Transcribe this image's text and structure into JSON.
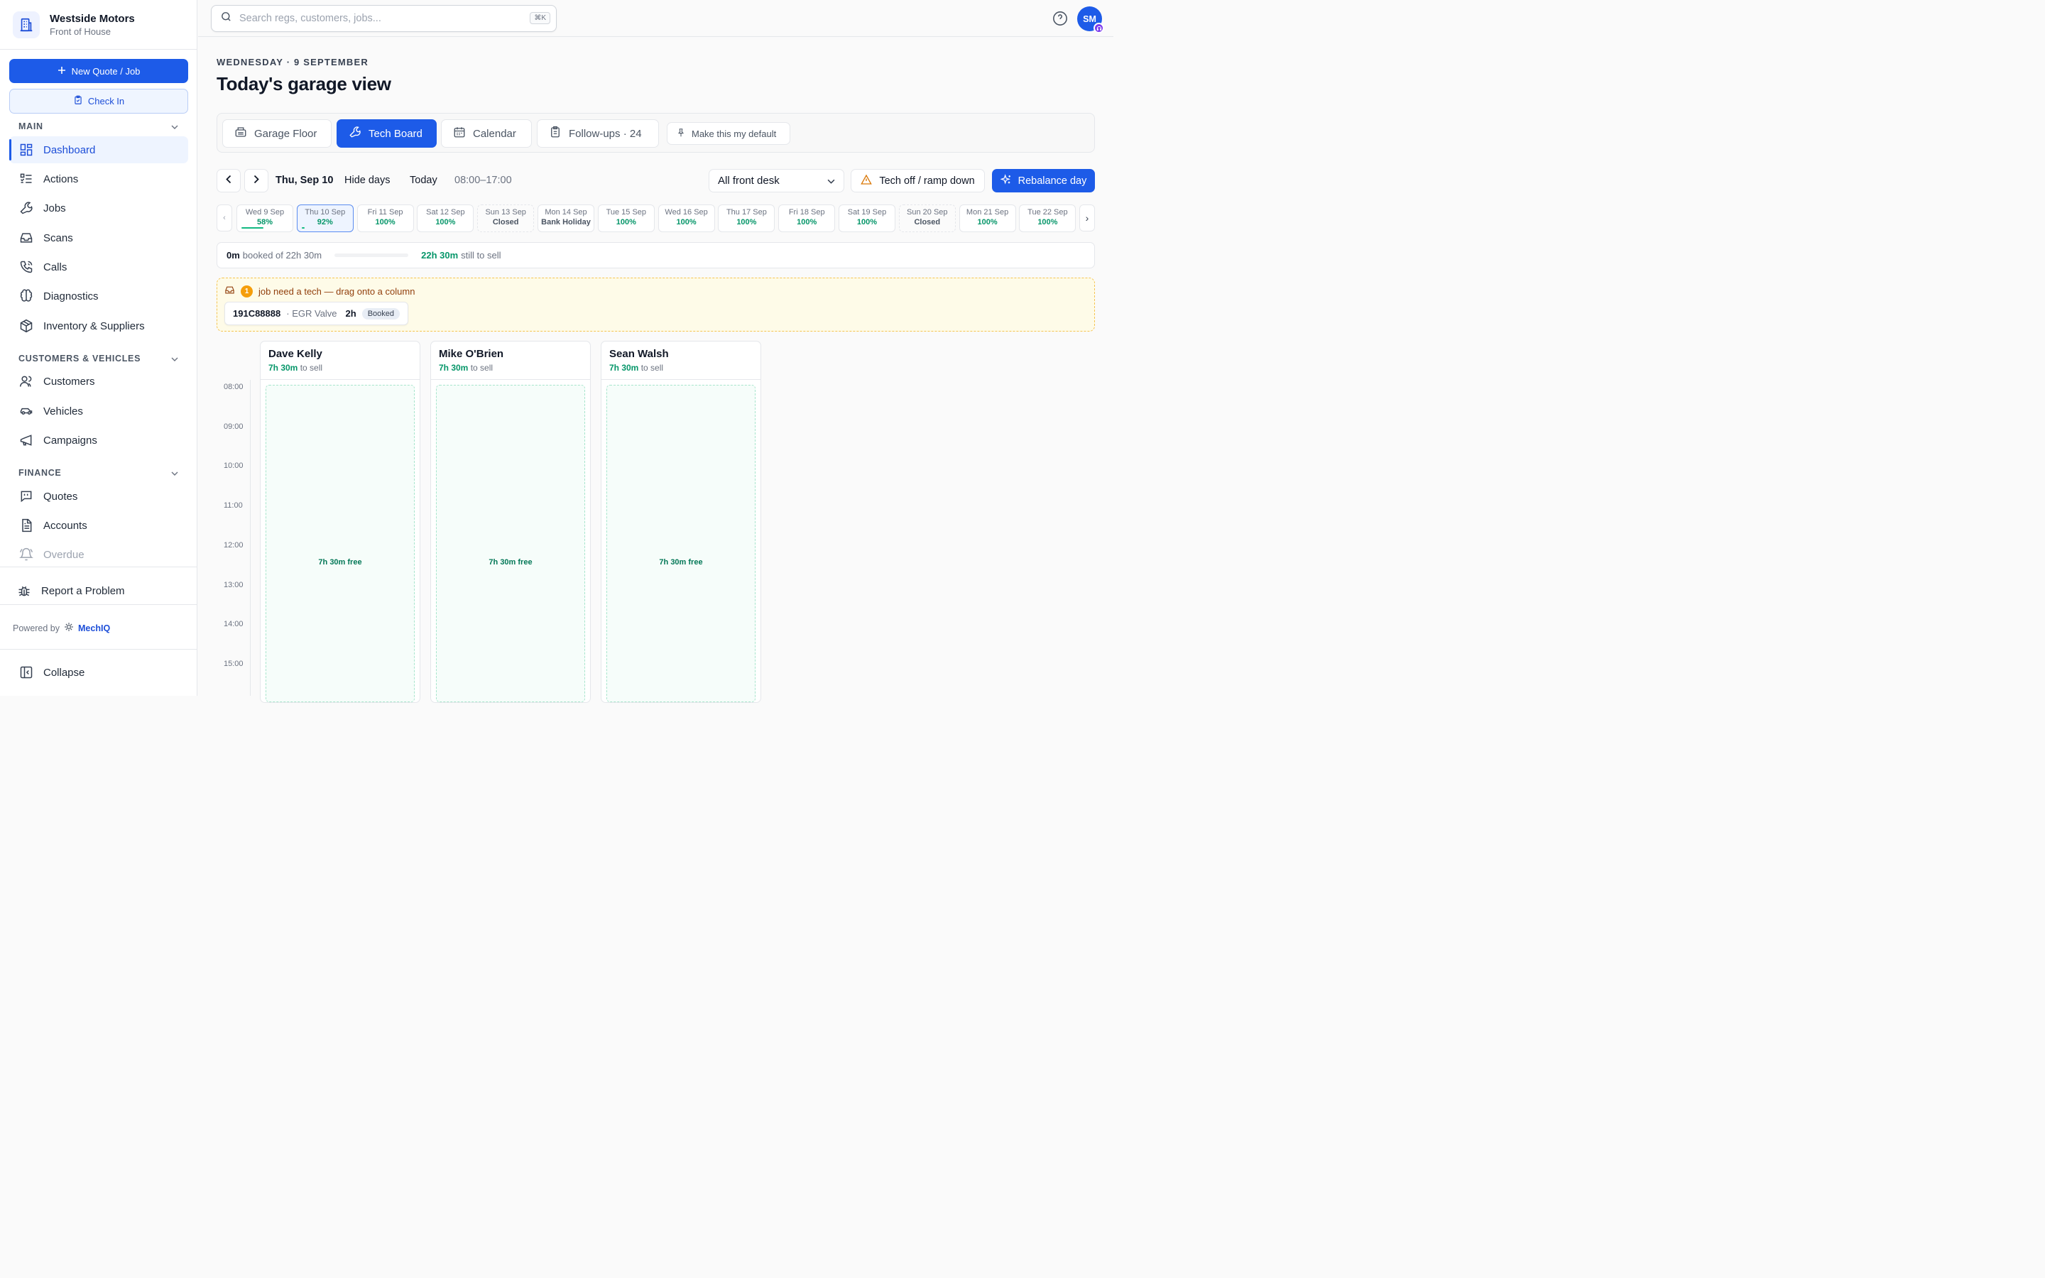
{
  "brand": {
    "name": "Westside Motors",
    "subtitle": "Front of House"
  },
  "sidebar": {
    "new_button": "New Quote / Job",
    "checkin_button": "Check In",
    "sections": {
      "main": "MAIN",
      "customers": "CUSTOMERS & VEHICLES",
      "finance": "FINANCE"
    },
    "main_items": [
      "Dashboard",
      "Actions",
      "Jobs",
      "Scans",
      "Calls",
      "Diagnostics",
      "Inventory & Suppliers"
    ],
    "customer_items": [
      "Customers",
      "Vehicles",
      "Campaigns"
    ],
    "finance_items": [
      "Quotes",
      "Accounts",
      "Overdue"
    ],
    "report": "Report a Problem",
    "powered_by": "Powered by",
    "powered_brand": "MechIQ",
    "collapse": "Collapse",
    "active_item": "Dashboard"
  },
  "topbar": {
    "search_placeholder": "Search regs, customers, jobs...",
    "shortcut": "⌘K",
    "avatar": "SM"
  },
  "page": {
    "date_line": "WEDNESDAY · 9 SEPTEMBER",
    "title": "Today's garage view"
  },
  "tabs": [
    "Garage Floor",
    "Tech Board",
    "Calendar",
    "Follow-ups · 24"
  ],
  "active_tab": "Tech Board",
  "default_button": "Make this my default",
  "toolbar": {
    "current_date": "Thu, Sep 10",
    "hide_days": "Hide days",
    "today": "Today",
    "hours": "08:00–17:00",
    "filter": "All front desk",
    "tech_off": "Tech off / ramp down",
    "rebalance": "Rebalance day"
  },
  "days": [
    {
      "label": "Wed 9 Sep",
      "value": "58%",
      "fill": 0.58,
      "state": "normal"
    },
    {
      "label": "Thu 10 Sep",
      "value": "92%",
      "fill": 0.08,
      "state": "selected"
    },
    {
      "label": "Fri 11 Sep",
      "value": "100%",
      "fill": 0,
      "state": "normal"
    },
    {
      "label": "Sat 12 Sep",
      "value": "100%",
      "fill": 0,
      "state": "normal"
    },
    {
      "label": "Sun 13 Sep",
      "value": "Closed",
      "fill": 0,
      "state": "closed"
    },
    {
      "label": "Mon 14 Sep",
      "value": "Bank Holiday",
      "fill": 0,
      "state": "holiday"
    },
    {
      "label": "Tue 15 Sep",
      "value": "100%",
      "fill": 0,
      "state": "normal"
    },
    {
      "label": "Wed 16 Sep",
      "value": "100%",
      "fill": 0,
      "state": "normal"
    },
    {
      "label": "Thu 17 Sep",
      "value": "100%",
      "fill": 0,
      "state": "normal"
    },
    {
      "label": "Fri 18 Sep",
      "value": "100%",
      "fill": 0,
      "state": "normal"
    },
    {
      "label": "Sat 19 Sep",
      "value": "100%",
      "fill": 0,
      "state": "normal"
    },
    {
      "label": "Sun 20 Sep",
      "value": "Closed",
      "fill": 0,
      "state": "closed"
    },
    {
      "label": "Mon 21 Sep",
      "value": "100%",
      "fill": 0,
      "state": "normal"
    },
    {
      "label": "Tue 22 Sep",
      "value": "100%",
      "fill": 0,
      "state": "normal"
    }
  ],
  "capacity": {
    "booked": "0m",
    "booked_suffix": "booked of 22h 30m",
    "remaining": "22h 30m",
    "remaining_suffix": "still to sell"
  },
  "unassigned": {
    "count": "1",
    "message": "job need a tech — drag onto a column",
    "jobs": [
      {
        "reg": "191C88888",
        "separator": "·",
        "description": "EGR Valve",
        "duration": "2h",
        "status": "Booked"
      }
    ]
  },
  "time_slots": [
    "08:00",
    "09:00",
    "10:00",
    "11:00",
    "12:00",
    "13:00",
    "14:00",
    "15:00"
  ],
  "techs": [
    {
      "name": "Dave Kelly",
      "to_sell": "7h 30m",
      "to_sell_suffix": "to sell",
      "free": "7h 30m free"
    },
    {
      "name": "Mike O'Brien",
      "to_sell": "7h 30m",
      "to_sell_suffix": "to sell",
      "free": "7h 30m free"
    },
    {
      "name": "Sean Walsh",
      "to_sell": "7h 30m",
      "to_sell_suffix": "to sell",
      "free": "7h 30m free"
    }
  ],
  "colors": {
    "primary": "#1d5be8",
    "success": "#059669",
    "warning": "#f59e0b"
  }
}
